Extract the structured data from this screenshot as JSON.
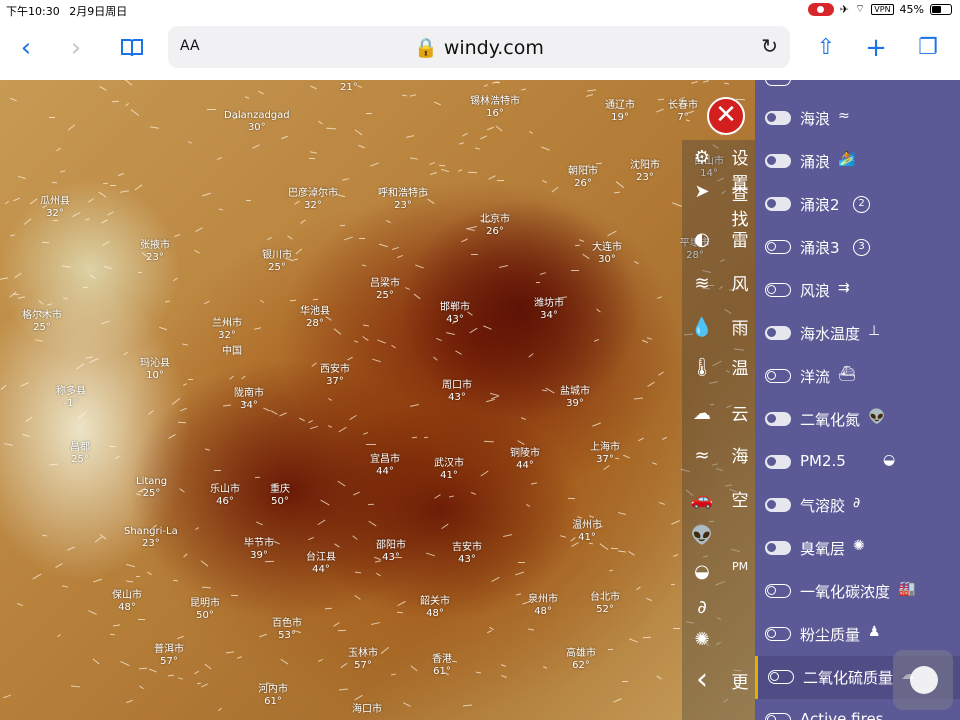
{
  "status": {
    "time": "下午10:30",
    "date": "2月9日周日",
    "vpn": "VPN",
    "battery": "45%"
  },
  "browser": {
    "text_size_label": "AA",
    "url": "windy.com"
  },
  "map": {
    "cities": [
      {
        "name": "锡林浩特市",
        "temp": "16°"
      },
      {
        "name": "通辽市",
        "temp": "19°"
      },
      {
        "name": "长春市",
        "temp": "7°"
      },
      {
        "name": "Dalanzadgad",
        "temp": "30°"
      },
      {
        "name": "巴彦淖尔市",
        "temp": "32°"
      },
      {
        "name": "呼和浩特市",
        "temp": "23°"
      },
      {
        "name": "朝阳市",
        "temp": "26°"
      },
      {
        "name": "沈阳市",
        "temp": "23°"
      },
      {
        "name": "白山市",
        "temp": "14°"
      },
      {
        "name": "瓜州县",
        "temp": "32°"
      },
      {
        "name": "北京市",
        "temp": "26°"
      },
      {
        "name": "张掖市",
        "temp": "23°"
      },
      {
        "name": "银川市",
        "temp": "25°"
      },
      {
        "name": "大连市",
        "temp": "30°"
      },
      {
        "name": "平壤市",
        "temp": "28°"
      },
      {
        "name": "吕梁市",
        "temp": "25°"
      },
      {
        "name": "格尔木市",
        "temp": "25°"
      },
      {
        "name": "兰州市",
        "temp": "32°"
      },
      {
        "name": "华池县",
        "temp": "28°"
      },
      {
        "name": "邯郸市",
        "temp": "43°"
      },
      {
        "name": "潍坊市",
        "temp": "34°"
      },
      {
        "name": "玛沁县",
        "temp": "10°"
      },
      {
        "name": "西安市",
        "temp": "37°"
      },
      {
        "name": "称多县",
        "temp": "-1°"
      },
      {
        "name": "陇南市",
        "temp": "34°"
      },
      {
        "name": "周口市",
        "temp": "43°"
      },
      {
        "name": "盐城市",
        "temp": "39°"
      },
      {
        "name": "昌都",
        "temp": "25°"
      },
      {
        "name": "宜昌市",
        "temp": "44°"
      },
      {
        "name": "武汉市",
        "temp": "41°"
      },
      {
        "name": "铜陵市",
        "temp": "44°"
      },
      {
        "name": "上海市",
        "temp": "37°"
      },
      {
        "name": "Litang",
        "temp": "25°"
      },
      {
        "name": "乐山市",
        "temp": "46°"
      },
      {
        "name": "重庆",
        "temp": "50°"
      },
      {
        "name": "Shangri-La",
        "temp": "23°"
      },
      {
        "name": "温州市",
        "temp": "41°"
      },
      {
        "name": "毕节市",
        "temp": "39°"
      },
      {
        "name": "邵阳市",
        "temp": "43°"
      },
      {
        "name": "吉安市",
        "temp": "43°"
      },
      {
        "name": "台江县",
        "temp": "44°"
      },
      {
        "name": "保山市",
        "temp": "48°"
      },
      {
        "name": "昆明市",
        "temp": "50°"
      },
      {
        "name": "韶关市",
        "temp": "48°"
      },
      {
        "name": "泉州市",
        "temp": "48°"
      },
      {
        "name": "台北市",
        "temp": "52°"
      },
      {
        "name": "百色市",
        "temp": "53°"
      },
      {
        "name": "普洱市",
        "temp": "57°"
      },
      {
        "name": "玉林市",
        "temp": "57°"
      },
      {
        "name": "香港",
        "temp": "61°"
      },
      {
        "name": "高雄市",
        "temp": "62°"
      },
      {
        "name": "河内市",
        "temp": "61°"
      },
      {
        "name": "海口市",
        "temp": ""
      },
      {
        "name": "中国",
        "temp": ""
      }
    ],
    "top_label": "21°"
  },
  "side_labels": [
    "设置",
    "查找",
    "雷",
    "风",
    "雨",
    "温",
    "云",
    "海",
    "空",
    "PM",
    "更"
  ],
  "side_icons": [
    "gear-icon",
    "locate-icon",
    "globe-icon",
    "wind-icon",
    "rain-drop-icon",
    "thermometer-icon",
    "cloud-icon",
    "waves-icon",
    "car-icon",
    "alien-icon",
    "ozone-icon",
    "aerosol-icon",
    "spiral-icon",
    "chevron-left-icon"
  ],
  "panel": {
    "items": [
      {
        "label": "海浪",
        "sym": "≈",
        "on": true
      },
      {
        "label": "涌浪",
        "sym": "🏄",
        "on": true
      },
      {
        "label": "涌浪2",
        "sym": "2",
        "on": true,
        "badge": true
      },
      {
        "label": "涌浪3",
        "sym": "3",
        "on": false,
        "badge": true
      },
      {
        "label": "风浪",
        "sym": "⇉",
        "on": false
      },
      {
        "label": "海水温度",
        "sym": "⊥",
        "on": true
      },
      {
        "label": "洋流",
        "sym": "⛴",
        "on": false
      },
      {
        "label": "二氧化氮",
        "sym": "👽",
        "on": true
      },
      {
        "label": "PM2.5",
        "sym": "◒",
        "on": true
      },
      {
        "label": "气溶胶",
        "sym": "∂",
        "on": true
      },
      {
        "label": "臭氧层",
        "sym": "✺",
        "on": true
      },
      {
        "label": "一氧化碳浓度",
        "sym": "🏭",
        "on": false
      },
      {
        "label": "粉尘质量",
        "sym": "♟",
        "on": false
      },
      {
        "label": "二氧化硫质量",
        "sym": "☁",
        "on": false,
        "selected": true
      },
      {
        "label": "Active fires",
        "sym": "🔥",
        "on": false
      }
    ]
  }
}
